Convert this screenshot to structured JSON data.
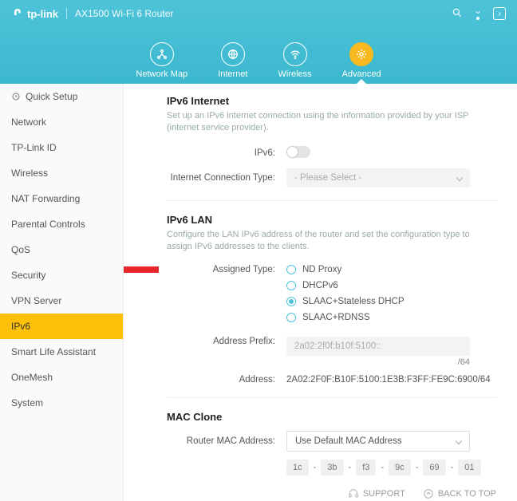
{
  "header": {
    "brand": "tp-link",
    "product": "AX1500 Wi-Fi 6 Router",
    "nav": [
      "Network Map",
      "Internet",
      "Wireless",
      "Advanced"
    ],
    "active_nav": "Advanced"
  },
  "sidebar": {
    "items": [
      "Quick Setup",
      "Network",
      "TP-Link ID",
      "Wireless",
      "NAT Forwarding",
      "Parental Controls",
      "QoS",
      "Security",
      "VPN Server",
      "IPv6",
      "Smart Life Assistant",
      "OneMesh",
      "System"
    ],
    "active": "IPv6"
  },
  "ipv6_internet": {
    "title": "IPv6 Internet",
    "desc": "Set up an IPv6 internet connection using the information provided by your ISP (internet service provider).",
    "ipv6_label": "IPv6:",
    "conn_type_label": "Internet Connection Type:",
    "conn_type_value": "- Please Select -"
  },
  "ipv6_lan": {
    "title": "IPv6 LAN",
    "desc": "Configure the LAN IPv6 address of the router and set the configuration type to assign IPv6 addresses to the clients.",
    "assigned_label": "Assigned Type:",
    "options": [
      "ND Proxy",
      "DHCPv6",
      "SLAAC+Stateless DHCP",
      "SLAAC+RDNSS"
    ],
    "selected": "SLAAC+Stateless DHCP",
    "prefix_label": "Address Prefix:",
    "prefix_value": "2a02:2f0f:b10f:5100::",
    "prefix_suffix": "/64",
    "address_label": "Address:",
    "address_value": "2A02:2F0F:B10F:5100:1E3B:F3FF:FE9C:6900/64"
  },
  "mac_clone": {
    "title": "MAC Clone",
    "router_mac_label": "Router MAC Address:",
    "router_mac_value": "Use Default MAC Address",
    "segments": [
      "1c",
      "3b",
      "f3",
      "9c",
      "69",
      "01"
    ]
  },
  "footer": {
    "support": "SUPPORT",
    "back": "BACK TO TOP"
  }
}
